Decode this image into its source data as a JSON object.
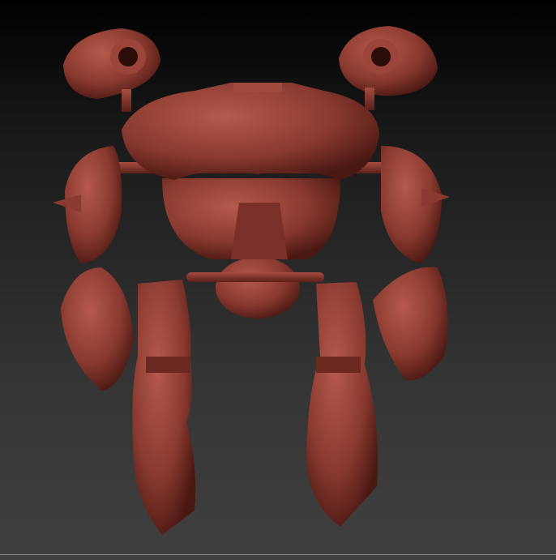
{
  "viewport": {
    "model": "robot-sculpt",
    "colors": {
      "material": "#8a3a30",
      "material_light": "#b0554a",
      "material_dark": "#3d1410",
      "background_top": "#000000",
      "background_bottom": "#404040"
    }
  }
}
